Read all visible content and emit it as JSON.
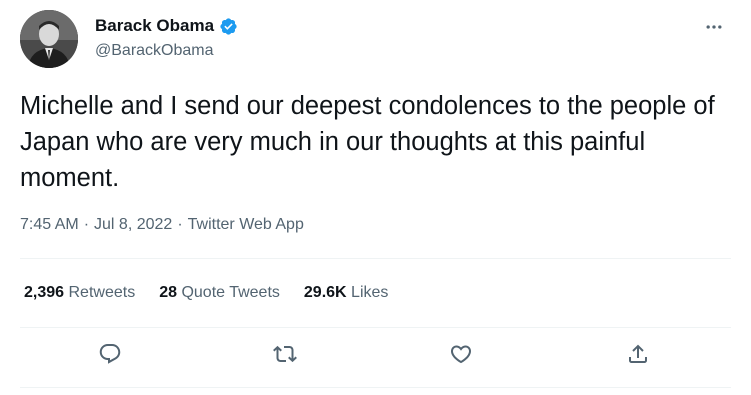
{
  "author": {
    "display_name": "Barack Obama",
    "handle": "@BarackObama",
    "verified": true,
    "avatar": "avatar-photo"
  },
  "tweet": {
    "text": "Michelle and I send our deepest condolences to the people of Japan who are very much in our thoughts at this painful moment.",
    "time": "7:45 AM",
    "separator": "·",
    "date": "Jul 8, 2022",
    "source": "Twitter Web App"
  },
  "stats": {
    "retweets_count": "2,396",
    "retweets_label": "Retweets",
    "quote_tweets_count": "28",
    "quote_tweets_label": "Quote Tweets",
    "likes_count": "29.6K",
    "likes_label": "Likes"
  },
  "icons": {
    "more": "more-icon",
    "verified": "verified-badge-icon",
    "reply": "reply-icon",
    "retweet": "retweet-icon",
    "like": "heart-icon",
    "share": "share-icon"
  },
  "colors": {
    "text_primary": "#0f1419",
    "text_secondary": "#536471",
    "verified_blue": "#1d9bf0",
    "divider": "#eff3f4"
  }
}
